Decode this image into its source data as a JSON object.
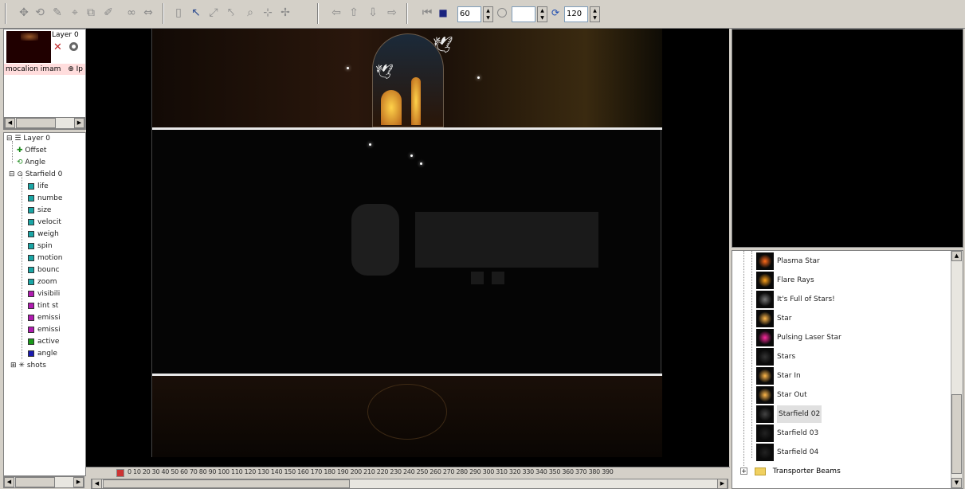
{
  "toolbar": {
    "frame_rate": "60",
    "angle": "",
    "frame_count": "120"
  },
  "layer_thumbnail": {
    "layer_name": "Layer 0",
    "file_name": "mocalion imam",
    "extra": "Ip"
  },
  "tree": {
    "root": "Layer 0",
    "offset": "Offset",
    "angle": "Angle",
    "emitter": "Starfield 0",
    "attributes": [
      {
        "label": "life",
        "color": "#1aa6a6"
      },
      {
        "label": "numbe",
        "color": "#1aa6a6"
      },
      {
        "label": "size",
        "color": "#1aa6a6"
      },
      {
        "label": "velocit",
        "color": "#1aa6a6"
      },
      {
        "label": "weigh",
        "color": "#1aa6a6"
      },
      {
        "label": "spin",
        "color": "#1aa6a6"
      },
      {
        "label": "motion",
        "color": "#1aa6a6"
      },
      {
        "label": "bounc",
        "color": "#1aa6a6"
      },
      {
        "label": "zoom",
        "color": "#1aa6a6"
      },
      {
        "label": "visibili",
        "color": "#b01ab0"
      },
      {
        "label": "tint st",
        "color": "#b01ab0"
      },
      {
        "label": "emissi",
        "color": "#b01ab0"
      },
      {
        "label": "emissi",
        "color": "#b01ab0"
      },
      {
        "label": "active",
        "color": "#1a9a1a"
      },
      {
        "label": "angle",
        "color": "#1a1ab0"
      }
    ],
    "shots": "shots"
  },
  "timeline": {
    "ruler": "0  10  20  30  40  50  60  70  80  90  100 110 120 130 140 150 160 170 180 190 200 210 220 230 240 250 260 270 280 290 300 310 320 330 340 350 360 370 380 390"
  },
  "library": {
    "items": [
      {
        "label": "Plasma Star",
        "thumb": "#ff6a1a"
      },
      {
        "label": "Flare Rays",
        "thumb": "#ffa21a"
      },
      {
        "label": "It's Full of Stars!",
        "thumb": "#777777"
      },
      {
        "label": "Star",
        "thumb": "#ffb84a"
      },
      {
        "label": "Pulsing Laser Star",
        "thumb": "#ff2aa0"
      },
      {
        "label": "Stars",
        "thumb": "#333333"
      },
      {
        "label": "Star In",
        "thumb": "#ffb84a"
      },
      {
        "label": "Star Out",
        "thumb": "#ffb84a"
      },
      {
        "label": "Starfield 02",
        "thumb": "#444444"
      },
      {
        "label": "Starfield 03",
        "thumb": "#222222"
      },
      {
        "label": "Starfield 04",
        "thumb": "#222222"
      }
    ],
    "folder": "Transporter Beams",
    "selected_index": 8
  },
  "colors": {
    "workspace": "#d4d0c8",
    "canvas": "#000000"
  }
}
